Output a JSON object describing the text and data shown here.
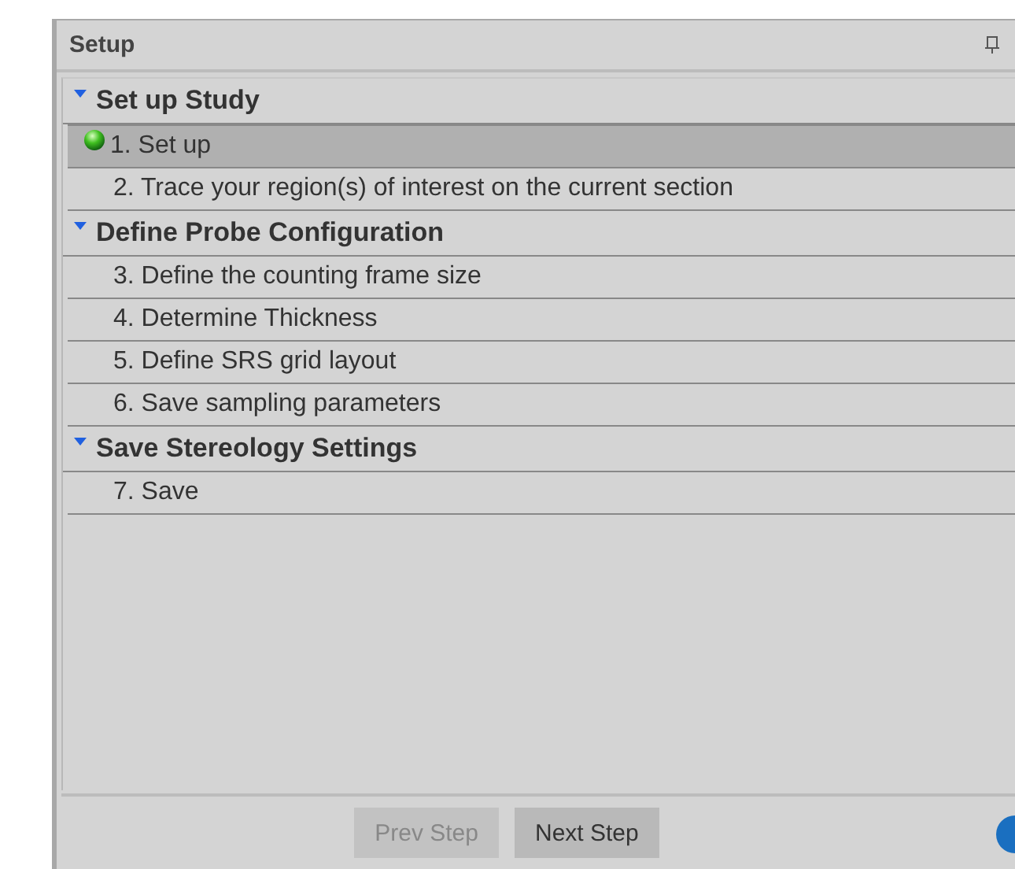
{
  "panel": {
    "title": "Setup"
  },
  "groups": [
    {
      "title": "Set up Study",
      "expanded": true,
      "steps": [
        {
          "label": "1. Set up",
          "selected": true,
          "current": true
        },
        {
          "label": "2. Trace your region(s) of interest on the current section",
          "selected": false,
          "current": false
        }
      ]
    },
    {
      "title": "Define Probe Configuration",
      "expanded": true,
      "steps": [
        {
          "label": "3. Define the counting frame size",
          "selected": false,
          "current": false
        },
        {
          "label": "4. Determine Thickness",
          "selected": false,
          "current": false
        },
        {
          "label": "5. Define SRS grid layout",
          "selected": false,
          "current": false
        },
        {
          "label": "6. Save sampling parameters",
          "selected": false,
          "current": false
        }
      ]
    },
    {
      "title": "Save Stereology Settings",
      "expanded": true,
      "steps": [
        {
          "label": "7. Save",
          "selected": false,
          "current": false
        }
      ]
    }
  ],
  "buttons": [
    {
      "label": "Prev Step",
      "disabled": true
    },
    {
      "label": "Next Step",
      "disabled": false
    }
  ]
}
